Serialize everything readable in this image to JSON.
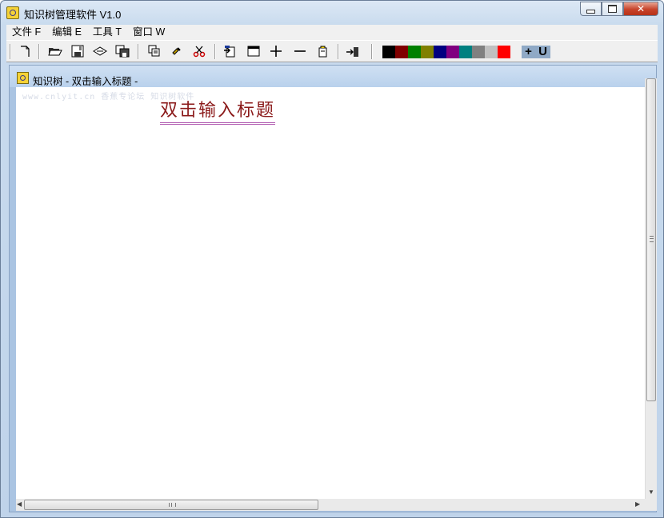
{
  "window": {
    "title": "知识树管理软件 V1.0"
  },
  "menu": [
    "文件 F",
    "编辑 E",
    "工具 T",
    "窗口 W"
  ],
  "toolbar": {
    "buttons": [
      "new-icon",
      "open-folder-icon",
      "save-icon",
      "link-icon",
      "save-as-icon",
      "copy-icon",
      "paste-icon",
      "cut-icon",
      "insert-node-icon",
      "window-icon",
      "add-icon",
      "remove-icon",
      "clipboard-icon",
      "move-icon"
    ],
    "colors": [
      "#000000",
      "#800000",
      "#008000",
      "#808000",
      "#000080",
      "#800080",
      "#008080",
      "#808080",
      "#c0c0c0",
      "#ff0000"
    ],
    "bold_plus": "+",
    "underline": "U"
  },
  "child": {
    "title": "知识树 - 双击输入标题 -",
    "watermark": "www.cnlyit.cn  香蕉专论坛  知识树软件",
    "heading": "双击输入标题"
  }
}
